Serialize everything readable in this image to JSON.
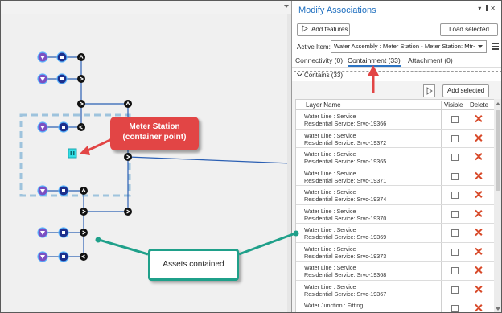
{
  "panel": {
    "title": "Modify Associations",
    "add_features_label": "Add features",
    "load_selected_label": "Load selected",
    "active_item_label": "Active Item:",
    "active_item_value": "Water Assembly : Meter Station - Meter Station: Mtr-",
    "tabs": [
      {
        "label": "Connectivity (0)"
      },
      {
        "label": "Containment (33)"
      },
      {
        "label": "Attachment (0)"
      }
    ],
    "section_label": "Contains (33)",
    "add_selected_label": "Add selected",
    "table": {
      "headers": {
        "name": "Layer Name",
        "visible": "Visible",
        "delete": "Delete"
      },
      "rows": [
        {
          "line1": "Water Line : Service",
          "line2": "Residential Service: Srvc-19366"
        },
        {
          "line1": "Water Line : Service",
          "line2": "Residential Service: Srvc-19372"
        },
        {
          "line1": "Water Line : Service",
          "line2": "Residential Service: Srvc-19365"
        },
        {
          "line1": "Water Line : Service",
          "line2": "Residential Service: Srvc-19371"
        },
        {
          "line1": "Water Line : Service",
          "line2": "Residential Service: Srvc-19374"
        },
        {
          "line1": "Water Line : Service",
          "line2": "Residential Service: Srvc-19370"
        },
        {
          "line1": "Water Line : Service",
          "line2": "Residential Service: Srvc-19369"
        },
        {
          "line1": "Water Line : Service",
          "line2": "Residential Service: Srvc-19373"
        },
        {
          "line1": "Water Line : Service",
          "line2": "Residential Service: Srvc-19368"
        },
        {
          "line1": "Water Line : Service",
          "line2": "Residential Service: Srvc-19367"
        },
        {
          "line1": "Water Junction : Fitting",
          "line2": ""
        }
      ]
    }
  },
  "callouts": {
    "meter_station_line1": "Meter Station",
    "meter_station_line2": "(container point)",
    "assets": "Assets contained"
  },
  "colors": {
    "accent_blue": "#1f6fbf",
    "callout_red": "#e24545",
    "callout_green": "#1fa08a",
    "delete_red": "#d84a2a",
    "line_blue": "#2b5fb3",
    "container_point": "#33e0e6"
  },
  "icons": {
    "map_symbols": [
      "meter-icon",
      "valve-icon",
      "fitting-icon",
      "container-point-icon"
    ],
    "panel": [
      "add-features-icon",
      "menu-icon",
      "chevron-down-icon",
      "delete-icon",
      "checkbox"
    ]
  }
}
